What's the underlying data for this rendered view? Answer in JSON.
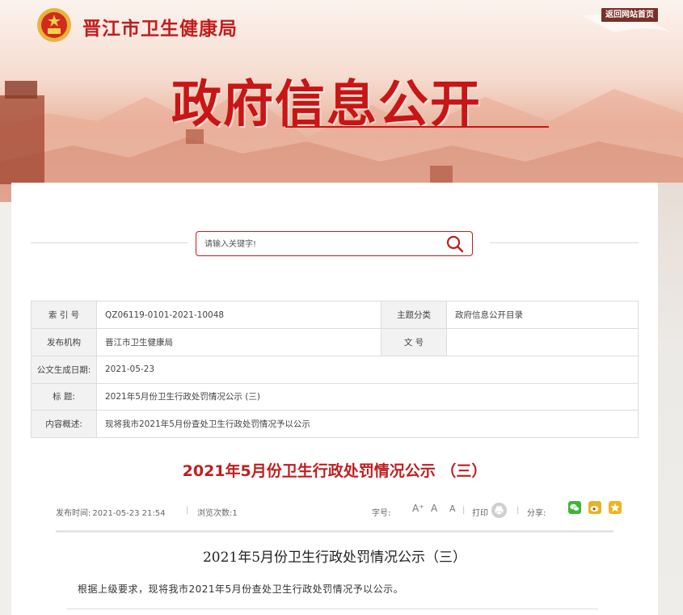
{
  "header": {
    "site_name": "晋江市卫生健康局",
    "home_link": "返回网站首页",
    "banner_title": "政府信息公开"
  },
  "search": {
    "placeholder": "请输入关键字!"
  },
  "meta": {
    "index_label": "索 引 号",
    "index_value": "QZ06119-0101-2021-10048",
    "topic_label": "主题分类",
    "topic_value": "政府信息公开目录",
    "publisher_label": "发布机构",
    "publisher_value": "晋江市卫生健康局",
    "docno_label": "文 号",
    "docno_value": "",
    "date_label": "公文生成日期:",
    "date_value": "2021-05-23",
    "title_label": "标 题:",
    "title_value": "2021年5月份卫生行政处罚情况公示 (三)",
    "summary_label": "内容概述:",
    "summary_value": "现将我市2021年5月份查处卫生行政处罚情况予以公示"
  },
  "article": {
    "title": "2021年5月份卫生行政处罚情况公示 （三）",
    "publish_label": "发布时间:",
    "publish_time": "2021-05-23 21:54",
    "views_label": "浏览次数:",
    "views": "1",
    "font_size_label": "字号:",
    "font_large": "A⁺",
    "font_medium": "A",
    "font_small": "A",
    "print_label": "打印",
    "share_label": "分享:",
    "body_title": "2021年5月份卫生行政处罚情况公示（三）",
    "body_text": "根据上级要求，现将我市2021年5月份查处卫生行政处罚情况予以公示。"
  },
  "colors": {
    "brand_red": "#c21d1d",
    "wechat": "#3fb438",
    "weibo": "#e8b21c",
    "favorite": "#f3b21b"
  },
  "icons": {
    "logo": "national-emblem",
    "search": "search-icon",
    "print": "print-icon",
    "wechat": "wechat-icon",
    "weibo": "weibo-icon",
    "favorite": "star-icon"
  }
}
